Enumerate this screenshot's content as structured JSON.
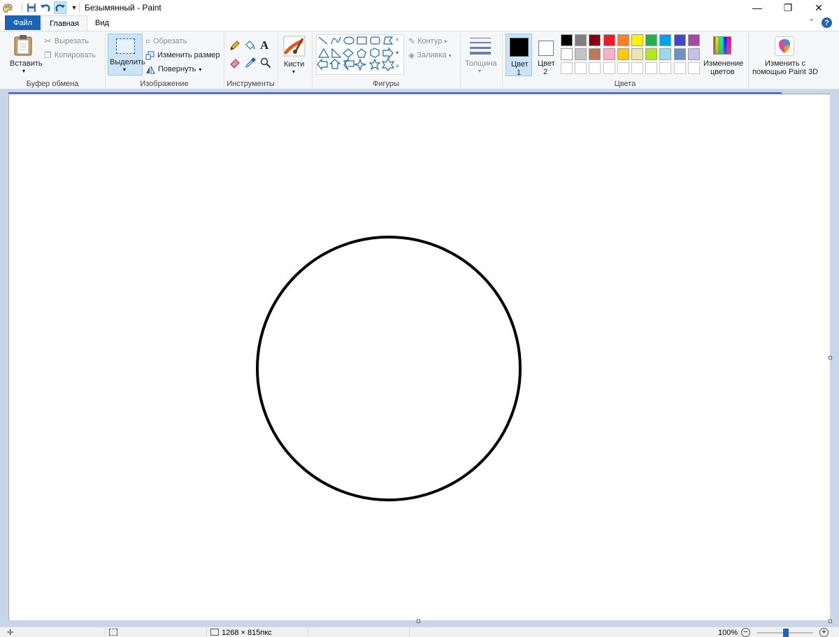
{
  "window": {
    "title": "Безымянный - Paint",
    "minimize": "—",
    "restore": "❐",
    "close": "✕"
  },
  "tabs": {
    "file": "Файл",
    "home": "Главная",
    "view": "Вид"
  },
  "clipboard": {
    "paste": "Вставить",
    "cut": "Вырезать",
    "copy": "Копировать",
    "group": "Буфер обмена"
  },
  "image": {
    "select": "Выделить",
    "crop": "Обрезать",
    "resize": "Изменить размер",
    "rotate": "Повернуть",
    "group": "Изображение"
  },
  "tools": {
    "group": "Инструменты",
    "text_glyph": "A"
  },
  "brushes": {
    "label": "Кисти"
  },
  "shapes": {
    "outline": "Контур",
    "fill": "Заливка",
    "group": "Фигуры"
  },
  "size": {
    "label": "Толщина"
  },
  "colors": {
    "color1_line1": "Цвет",
    "color1_line2": "1",
    "color2_line1": "Цвет",
    "color2_line2": "2",
    "edit_line1": "Изменение",
    "edit_line2": "цветов",
    "group": "Цвета",
    "color1_value": "#000000",
    "color2_value": "#ffffff",
    "palette_row1": [
      "#000000",
      "#7f7f7f",
      "#880015",
      "#ed1c24",
      "#ff7f27",
      "#fff200",
      "#22b14c",
      "#00a2e8",
      "#3f48cc",
      "#a349a4"
    ],
    "palette_row2": [
      "#ffffff",
      "#c3c3c3",
      "#b97a57",
      "#ffaec9",
      "#ffc90e",
      "#efe4b0",
      "#b5e61d",
      "#99d9ea",
      "#7092be",
      "#c8bfe7"
    ]
  },
  "paint3d": {
    "line1": "Изменить с",
    "line2": "помощью Paint 3D"
  },
  "status": {
    "dimensions": "1268 × 815пкс",
    "zoom": "100%"
  },
  "accent": "#1a64b8"
}
